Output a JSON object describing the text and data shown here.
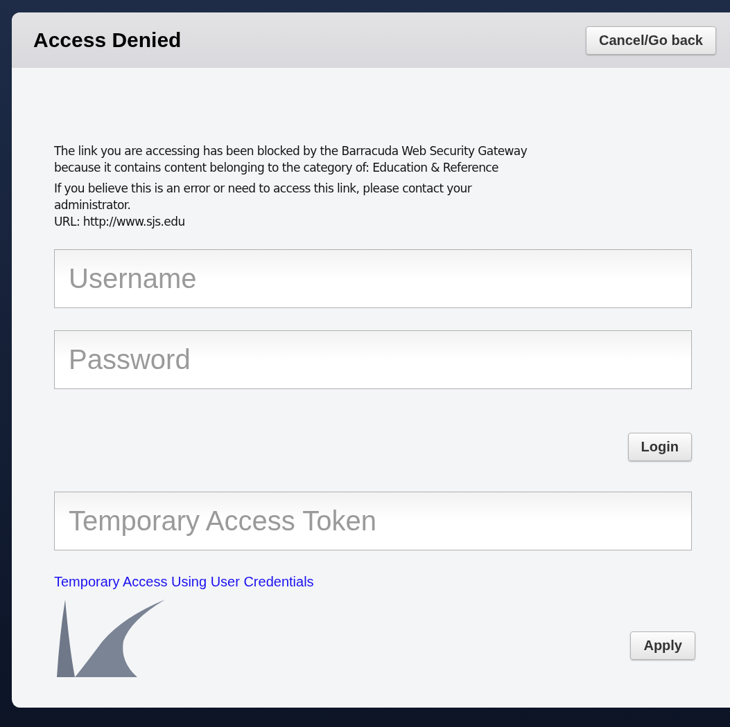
{
  "header": {
    "title": "Access Denied",
    "cancel_button": "Cancel/Go back"
  },
  "message": {
    "lines": [
      "The link you are accessing has been blocked by the Barracuda Web Security Gateway",
      "because it contains content belonging to the category of: Education & Reference"
    ],
    "contact": [
      "If you believe this is an error or need to access this link, please contact your",
      "administrator."
    ],
    "url": "URL: http://www.sjs.edu"
  },
  "login": {
    "username": {
      "placeholder": "Username"
    },
    "password": {
      "placeholder": "Password"
    },
    "button": "Login"
  },
  "token": {
    "field": {
      "placeholder": "Temporary Access Token"
    },
    "link": "Temporary Access Using User Credentials",
    "button": "Apply"
  }
}
